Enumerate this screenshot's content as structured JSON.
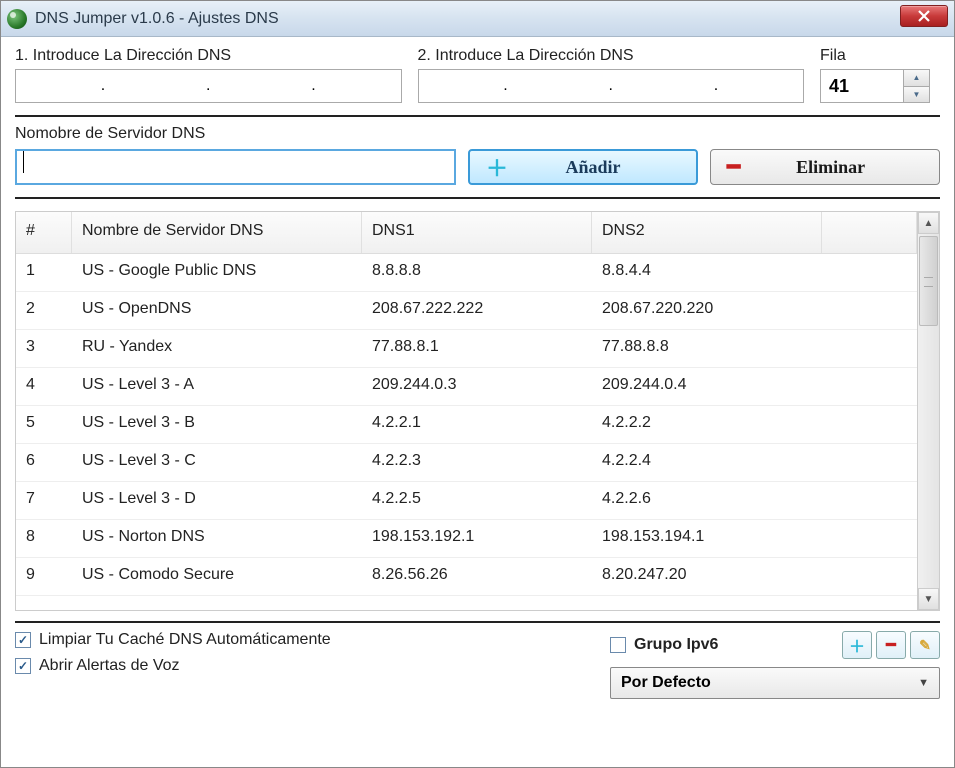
{
  "window": {
    "title": "DNS Jumper v1.0.6 -  Ajustes DNS"
  },
  "inputs": {
    "dns1_label": "1. Introduce La Dirección DNS",
    "dns2_label": "2. Introduce La Dirección DNS",
    "row_label": "Fila",
    "row_value": "41",
    "server_name_label": "Nomobre de Servidor DNS",
    "server_name_value": ""
  },
  "buttons": {
    "add": "Añadir",
    "delete": "Eliminar"
  },
  "table": {
    "headers": {
      "num": "#",
      "name": "Nombre de Servidor DNS",
      "dns1": "DNS1",
      "dns2": "DNS2"
    },
    "rows": [
      {
        "num": "1",
        "name": "US - Google Public DNS",
        "dns1": "8.8.8.8",
        "dns2": "8.8.4.4"
      },
      {
        "num": "2",
        "name": "US - OpenDNS",
        "dns1": "208.67.222.222",
        "dns2": "208.67.220.220"
      },
      {
        "num": "3",
        "name": "RU - Yandex",
        "dns1": "77.88.8.1",
        "dns2": "77.88.8.8"
      },
      {
        "num": "4",
        "name": "US - Level 3 - A",
        "dns1": "209.244.0.3",
        "dns2": "209.244.0.4"
      },
      {
        "num": "5",
        "name": "US - Level 3 - B",
        "dns1": "4.2.2.1",
        "dns2": "4.2.2.2"
      },
      {
        "num": "6",
        "name": "US - Level 3 - C",
        "dns1": "4.2.2.3",
        "dns2": "4.2.2.4"
      },
      {
        "num": "7",
        "name": "US - Level 3 - D",
        "dns1": "4.2.2.5",
        "dns2": "4.2.2.6"
      },
      {
        "num": "8",
        "name": "US - Norton DNS",
        "dns1": "198.153.192.1",
        "dns2": "198.153.194.1"
      },
      {
        "num": "9",
        "name": "US - Comodo Secure",
        "dns1": "8.26.56.26",
        "dns2": "8.20.247.20"
      }
    ]
  },
  "footer": {
    "clear_cache": "Limpiar Tu Caché DNS Automáticamente",
    "voice_alerts": "Abrir Alertas de Voz",
    "ipv6_group": "Grupo Ipv6",
    "dropdown": "Por Defecto"
  }
}
